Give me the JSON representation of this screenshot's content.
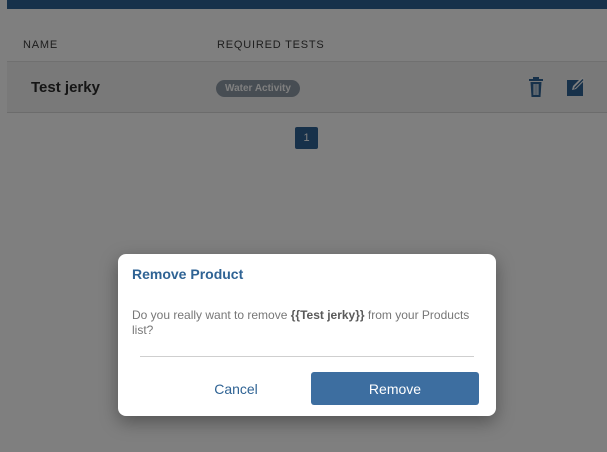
{
  "table": {
    "headers": {
      "name": "NAME",
      "required_tests": "REQUIRED TESTS"
    },
    "rows": [
      {
        "name": "Test jerky",
        "tests": [
          "Water Activity"
        ]
      }
    ]
  },
  "pagination": {
    "current": "1"
  },
  "icons": {
    "delete": "trash-icon",
    "edit": "edit-icon"
  },
  "dialog": {
    "title": "Remove Product",
    "message_prefix": "Do you really want to remove ",
    "message_product": "{{Test jerky}}",
    "message_suffix": " from your Products list?",
    "cancel_label": "Cancel",
    "confirm_label": "Remove"
  },
  "colors": {
    "accent": "#2f6394",
    "badge": "#8e9aa6",
    "overlay": "rgba(0,0,0,0.5)"
  }
}
